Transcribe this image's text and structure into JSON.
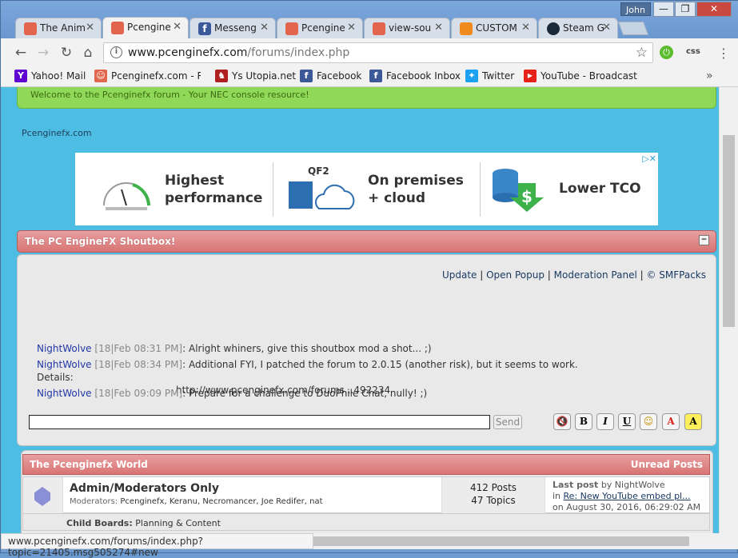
{
  "window": {
    "user": "John",
    "minimize": "—",
    "maximize": "❐",
    "close": "✕"
  },
  "tabs": [
    {
      "label": "The Anim",
      "color": "#e2664d",
      "icon": "site-icon"
    },
    {
      "label": "Pcengine",
      "color": "#e2664d",
      "icon": "site-icon"
    },
    {
      "label": "Messeng",
      "color": "#3b5998",
      "icon": "facebook-icon"
    },
    {
      "label": "Pcengine",
      "color": "#e2664d",
      "icon": "site-icon"
    },
    {
      "label": "view-sou",
      "color": "#e2664d",
      "icon": "site-icon"
    },
    {
      "label": "CUSTOM",
      "color": "#f08a1c",
      "icon": "custom-icon"
    },
    {
      "label": "Steam G",
      "color": "#1b2838",
      "icon": "steam-icon"
    }
  ],
  "address": {
    "domain": "www.pcenginefx.com",
    "path": "/forums/index.php"
  },
  "extensions": {
    "css": "css"
  },
  "bookmarks": [
    {
      "label": "Yahoo! Mail",
      "color": "#5f01d1",
      "glyph": "Y"
    },
    {
      "label": "Pcenginefx.com - Rec",
      "color": "#e2664d",
      "glyph": "☺"
    },
    {
      "label": "Ys Utopia.net",
      "color": "#b02020",
      "glyph": "♞"
    },
    {
      "label": "Facebook",
      "color": "#3b5998",
      "glyph": "f"
    },
    {
      "label": "Facebook Inbox",
      "color": "#3b5998",
      "glyph": "f"
    },
    {
      "label": "Twitter",
      "color": "#1da1f2",
      "glyph": "✦"
    },
    {
      "label": "YouTube - Broadcast",
      "color": "#e62117",
      "glyph": "▶"
    }
  ],
  "welcome": "Welcome to the Pcenginefx forum - Your NEC console resource!",
  "breadcrumb": "Pcenginefx.com",
  "ad": {
    "items": [
      {
        "line1": "Highest",
        "line2": "performance"
      },
      {
        "line1": "On premises",
        "line2": "+ cloud",
        "badge": "QF2"
      },
      {
        "line1": "Lower TCO",
        "line2": ""
      }
    ]
  },
  "shoutbox": {
    "title": "The PC EngineFX Shoutbox!",
    "links": [
      "Update",
      "Open Popup",
      "Moderation Panel",
      "© SMFPacks"
    ],
    "messages": [
      {
        "user": "NightWolve",
        "time": "[18|Feb 08:31 PM]",
        "text": ": Alright whiners, give this shoutbox mod a shot... ;)",
        "text2": ""
      },
      {
        "user": "NightWolve",
        "time": "[18|Feb 08:34 PM]",
        "text": ": Additional FYI, I patched the forum to 2.0.15 (another risk), but it seems to work. Details:",
        "text2": "http://www.pcenginefx.com/forums...492234"
      },
      {
        "user": "NightWolve",
        "time": "[18|Feb 09:09 PM]",
        "text": ": Prepare for a challenge to DuoPhile Chat, nully! ;)",
        "text2": ""
      }
    ],
    "input_value": "",
    "send": "Send",
    "format_buttons": [
      "B",
      "I",
      "U"
    ]
  },
  "world": {
    "title": "The Pcenginefx World",
    "unread": "Unread Posts",
    "board": {
      "name": "Admin/Moderators Only",
      "moderators_label": "Moderators:",
      "moderators": "Pcenginefx, Keranu, Necromancer, Joe Redifer, nat",
      "posts": "412 Posts",
      "topics": "47 Topics",
      "lastpost_label": "Last post",
      "lastpost_by": "by NightWolve",
      "lastpost_in": "in",
      "lastpost_link": "Re: New YouTube embed pl...",
      "lastpost_date": "on August 30, 2016, 06:29:02 AM",
      "child_label": "Child Boards:",
      "child_value": "Planning & Content"
    }
  },
  "statusbar": "www.pcenginefx.com/forums/index.php?topic=21405.msg505274#new"
}
